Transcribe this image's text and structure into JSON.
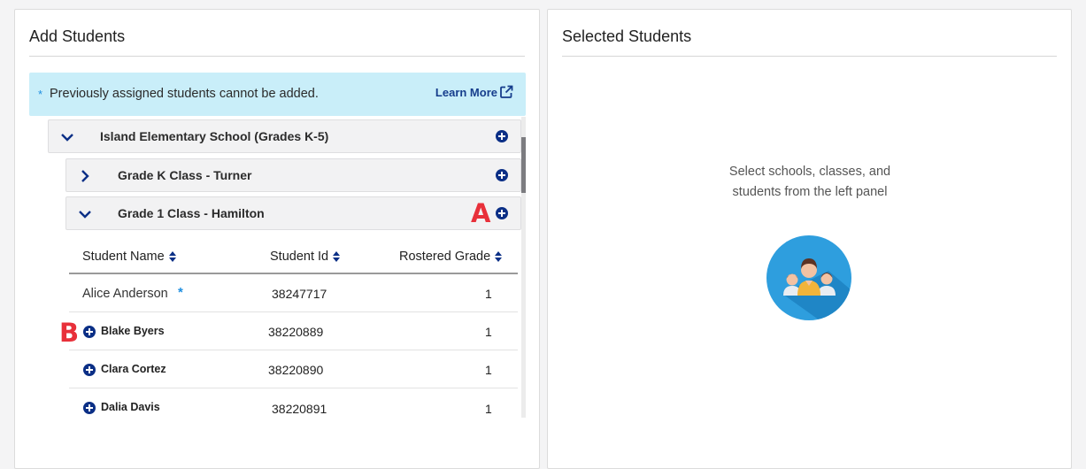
{
  "left_panel": {
    "title": "Add Students",
    "info_banner": {
      "star": "*",
      "text": "Previously assigned students cannot be added.",
      "link_label": "Learn More"
    },
    "tree": {
      "school": {
        "label": "Island Elementary School (Grades K-5)",
        "expanded": true
      },
      "classes": [
        {
          "label": "Grade K Class - Turner",
          "expanded": false
        },
        {
          "label": "Grade 1 Class - Hamilton",
          "expanded": true
        }
      ]
    },
    "table": {
      "columns": [
        "Student Name",
        "Student Id",
        "Rostered Grade"
      ],
      "rows": [
        {
          "name": "Alice Anderson",
          "id": "38247717",
          "grade": "1",
          "previously_assigned": true,
          "star": "*"
        },
        {
          "name": "Blake Byers",
          "id": "38220889",
          "grade": "1",
          "previously_assigned": false
        },
        {
          "name": "Clara Cortez",
          "id": "38220890",
          "grade": "1",
          "previously_assigned": false
        },
        {
          "name": "Dalia Davis",
          "id": "38220891",
          "grade": "1",
          "previously_assigned": false
        }
      ]
    }
  },
  "right_panel": {
    "title": "Selected Students",
    "empty_message": "Select schools, classes, and students from the left panel"
  },
  "annotations": {
    "a": "A",
    "b": "B"
  },
  "colors": {
    "accent_navy": "#0b2f86",
    "banner_bg": "#c9eef9",
    "star_blue": "#1f8fe0",
    "callout_red": "#e8303a",
    "illustration_blue": "#2e9ede"
  }
}
